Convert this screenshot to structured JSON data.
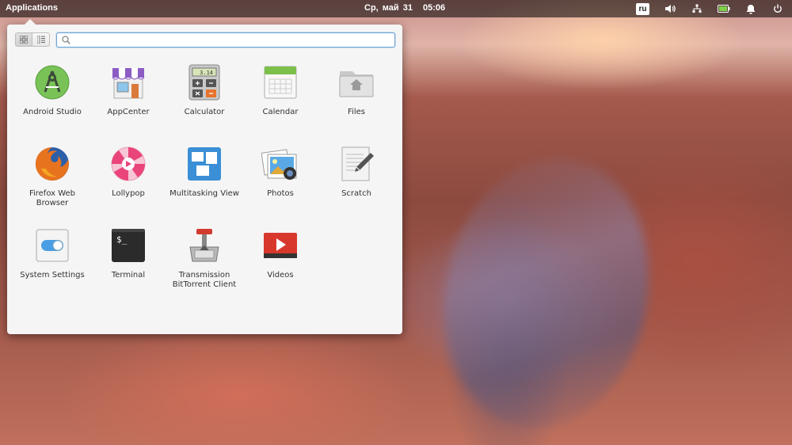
{
  "panel": {
    "applications_label": "Applications",
    "date": "Ср, май 31",
    "time": "05:06",
    "keyboard_layout": "ru"
  },
  "menu": {
    "search_value": "",
    "search_placeholder": "",
    "apps": [
      {
        "label": "Android Studio",
        "icon": "android-studio-icon"
      },
      {
        "label": "AppCenter",
        "icon": "appcenter-icon"
      },
      {
        "label": "Calculator",
        "icon": "calculator-icon",
        "display": "3.14"
      },
      {
        "label": "Calendar",
        "icon": "calendar-icon"
      },
      {
        "label": "Files",
        "icon": "files-icon"
      },
      {
        "label": "Firefox Web Browser",
        "icon": "firefox-icon"
      },
      {
        "label": "Lollypop",
        "icon": "lollypop-icon"
      },
      {
        "label": "Multitasking View",
        "icon": "multitasking-view-icon"
      },
      {
        "label": "Photos",
        "icon": "photos-icon"
      },
      {
        "label": "Scratch",
        "icon": "scratch-icon"
      },
      {
        "label": "System Settings",
        "icon": "system-settings-icon"
      },
      {
        "label": "Terminal",
        "icon": "terminal-icon",
        "prompt": "$_"
      },
      {
        "label": "Transmission BitTorrent Client",
        "icon": "transmission-icon"
      },
      {
        "label": "Videos",
        "icon": "videos-icon"
      }
    ]
  },
  "colors": {
    "panel_bg": "#000000",
    "menu_bg": "#f5f5f5",
    "search_focus": "#6ea4d8"
  }
}
